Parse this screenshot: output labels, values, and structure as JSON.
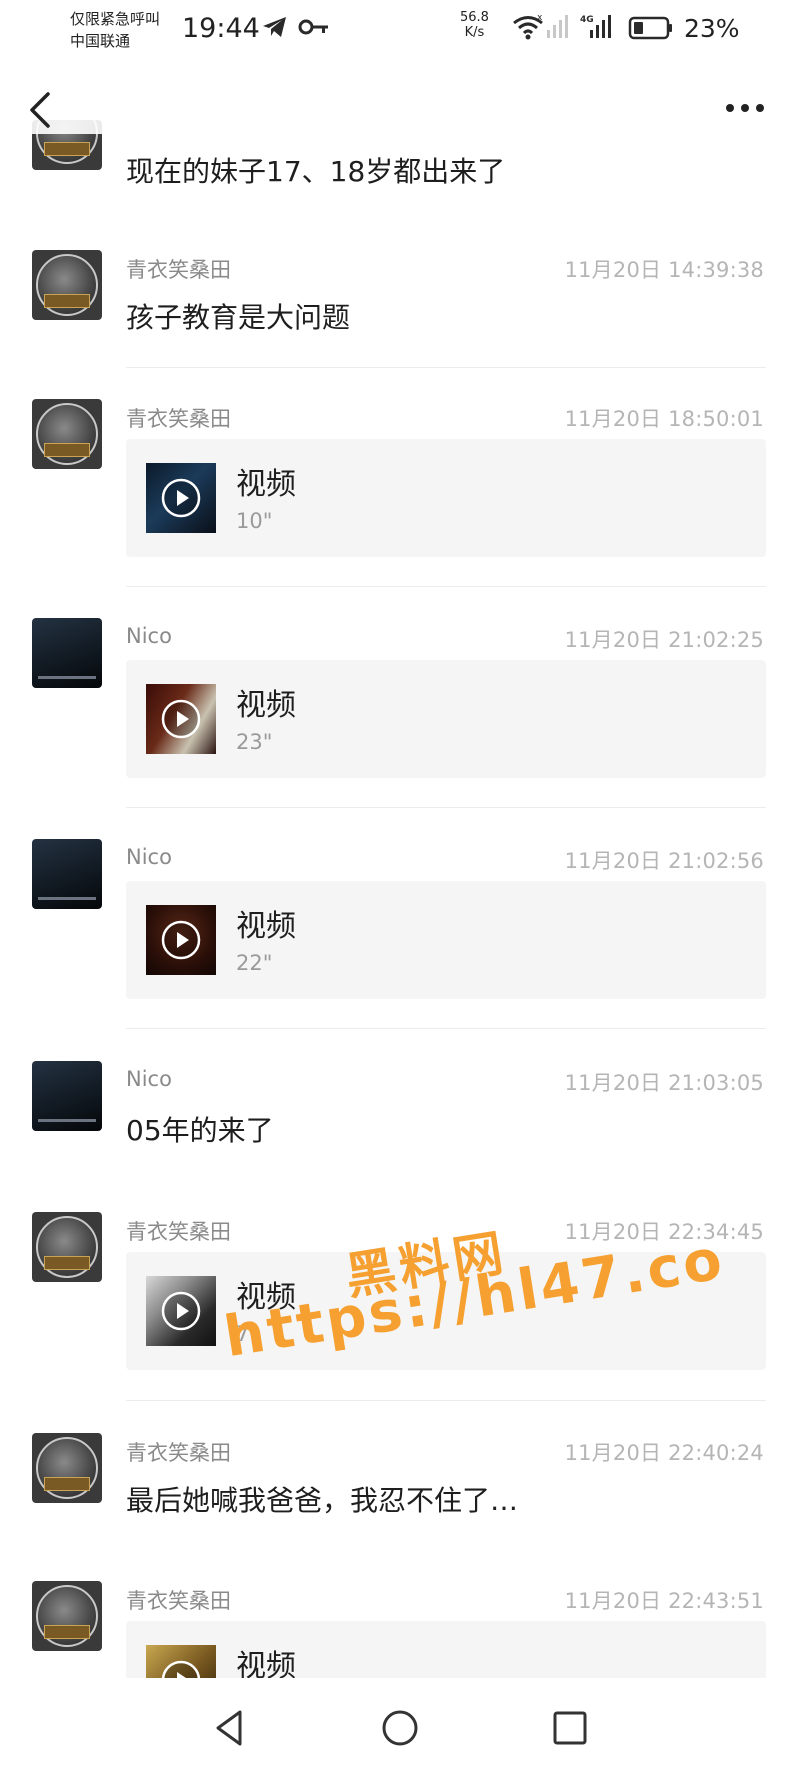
{
  "status_bar": {
    "carrier_line1": "仅限紧急呼叫",
    "carrier_line2": "中国联通",
    "time": "19:44",
    "net_speed_value": "56.8",
    "net_speed_unit": "K/s",
    "network_type": "4G",
    "battery": "23%",
    "icons": [
      "telegram-icon",
      "key-icon",
      "wifi-icon",
      "signal-icon",
      "battery-icon"
    ]
  },
  "top_bar": {
    "back_icon": "chevron-left-icon",
    "more_icon": "more-horizontal-icon"
  },
  "messages": [
    {
      "name": "",
      "time": "",
      "type": "text",
      "text": "现在的妹子17、18岁都出来了",
      "avatar": "round"
    },
    {
      "name": "青衣笑桑田",
      "time": "11月20日 14:39:38",
      "type": "text",
      "text": "孩子教育是大问题",
      "avatar": "round"
    },
    {
      "name": "青衣笑桑田",
      "time": "11月20日 18:50:01",
      "type": "video",
      "label": "视频",
      "duration": "10\"",
      "avatar": "round"
    },
    {
      "name": "Nico",
      "time": "11月20日 21:02:25",
      "type": "video",
      "label": "视频",
      "duration": "23\"",
      "avatar": "dark"
    },
    {
      "name": "Nico",
      "time": "11月20日 21:02:56",
      "type": "video",
      "label": "视频",
      "duration": "22\"",
      "avatar": "dark"
    },
    {
      "name": "Nico",
      "time": "11月20日 21:03:05",
      "type": "text",
      "text": "05年的来了",
      "avatar": "dark"
    },
    {
      "name": "青衣笑桑田",
      "time": "11月20日 22:34:45",
      "type": "video",
      "label": "视频",
      "duration": "7\"",
      "avatar": "round"
    },
    {
      "name": "青衣笑桑田",
      "time": "11月20日 22:40:24",
      "type": "text",
      "text": "最后她喊我爸爸，我忍不住了…",
      "avatar": "round"
    },
    {
      "name": "青衣笑桑田",
      "time": "11月20日 22:43:51",
      "type": "video",
      "label": "视频",
      "duration": "",
      "avatar": "round"
    }
  ],
  "watermark": {
    "line1": "黑料网",
    "line2": "https://hl47.co",
    "color": "#f5a030"
  },
  "nav_bar": {
    "icons": [
      "nav-back-icon",
      "nav-home-icon",
      "nav-recents-icon"
    ]
  }
}
